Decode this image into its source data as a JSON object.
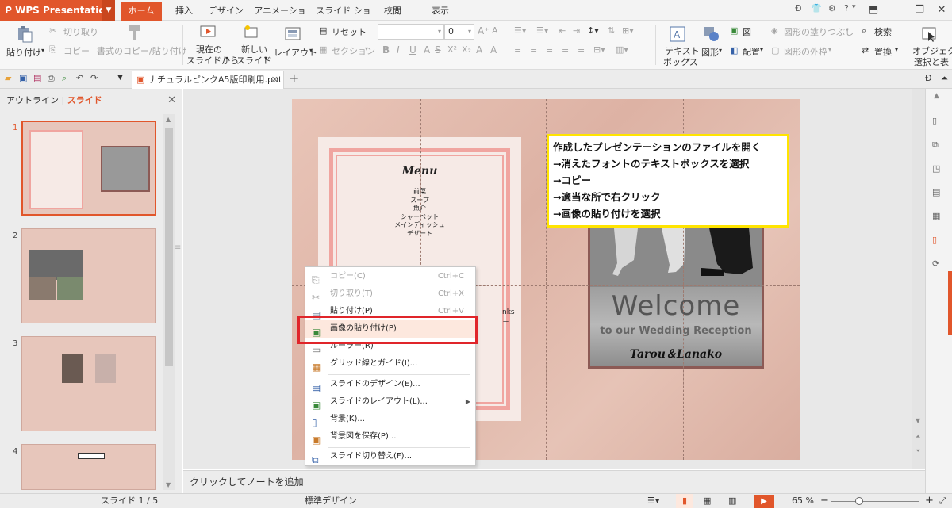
{
  "app": {
    "name": "WPS Presentation"
  },
  "tabs": [
    "ホーム",
    "挿入",
    "デザイン",
    "アニメーション",
    "スライド ショー",
    "校閲",
    "表示"
  ],
  "ribbon": {
    "paste": "貼り付け",
    "cut": "切り取り",
    "copy": "コピー",
    "format_painter": "書式のコピー/貼り付け",
    "from_current_l1": "現在の",
    "from_current_l2": "スライドから",
    "new_slide_l1": "新しい",
    "new_slide_l2": "スライド",
    "layout": "レイアウト",
    "reset": "リセット",
    "section": "セクション",
    "font_size": "0",
    "textbox_l1": "テキスト",
    "textbox_l2": "ボックス",
    "shape": "図形",
    "picture": "図",
    "arrange": "配置",
    "shape_fill": "図形の塗りつぶし",
    "shape_outline": "図形の外枠",
    "find": "検索",
    "replace": "置換",
    "object_l1": "オブジェク",
    "object_l2": "選択と表"
  },
  "document": {
    "tab_name": "ナチュラルピンクA5版印刷用.ppt"
  },
  "left_pane": {
    "outline_tab": "アウトライン",
    "slides_tab": "スライド",
    "slide_numbers": [
      "1",
      "2",
      "3",
      "4"
    ]
  },
  "slide": {
    "menu_title": "Menu",
    "menu_items": [
      "前菜",
      "スープ",
      "魚介",
      "シャーベット",
      "メインディッシュ",
      "デザート"
    ],
    "drinks_text": "nks－",
    "welcome": "Welcome",
    "welcome_sub": "to our Wedding Reception",
    "names": "Tarou＆Lanako"
  },
  "callout": {
    "lines": [
      "作成したプレゼンテーションのファイルを開く",
      "→消えたフォントのテキストボックスを選択",
      "→コピー",
      "→適当な所で右クリック",
      "→画像の貼り付けを選択"
    ]
  },
  "context_menu": {
    "items": [
      {
        "label": "コピー(C)",
        "shortcut": "Ctrl+C"
      },
      {
        "label": "切り取り(T)",
        "shortcut": "Ctrl+X"
      },
      {
        "label": "貼り付け(P)",
        "shortcut": "Ctrl+V"
      },
      {
        "label": "画像の貼り付け(P)",
        "shortcut": ""
      },
      {
        "label": "ルーラー(R)",
        "shortcut": ""
      },
      {
        "label": "グリッド線とガイド(I)...",
        "shortcut": ""
      },
      {
        "label": "スライドのデザイン(E)...",
        "shortcut": ""
      },
      {
        "label": "スライドのレイアウト(L)...",
        "shortcut": ""
      },
      {
        "label": "背景(K)...",
        "shortcut": ""
      },
      {
        "label": "背景図を保存(P)...",
        "shortcut": ""
      },
      {
        "label": "スライド切り替え(F)...",
        "shortcut": ""
      }
    ]
  },
  "notes": {
    "placeholder": "クリックしてノートを追加"
  },
  "status": {
    "slide": "スライド 1 / 5",
    "design": "標準デザイン",
    "zoom": "65 %"
  },
  "colors": {
    "accent": "#e1562b",
    "callout_border": "#ffe400",
    "highlight_box": "#e0252a"
  }
}
